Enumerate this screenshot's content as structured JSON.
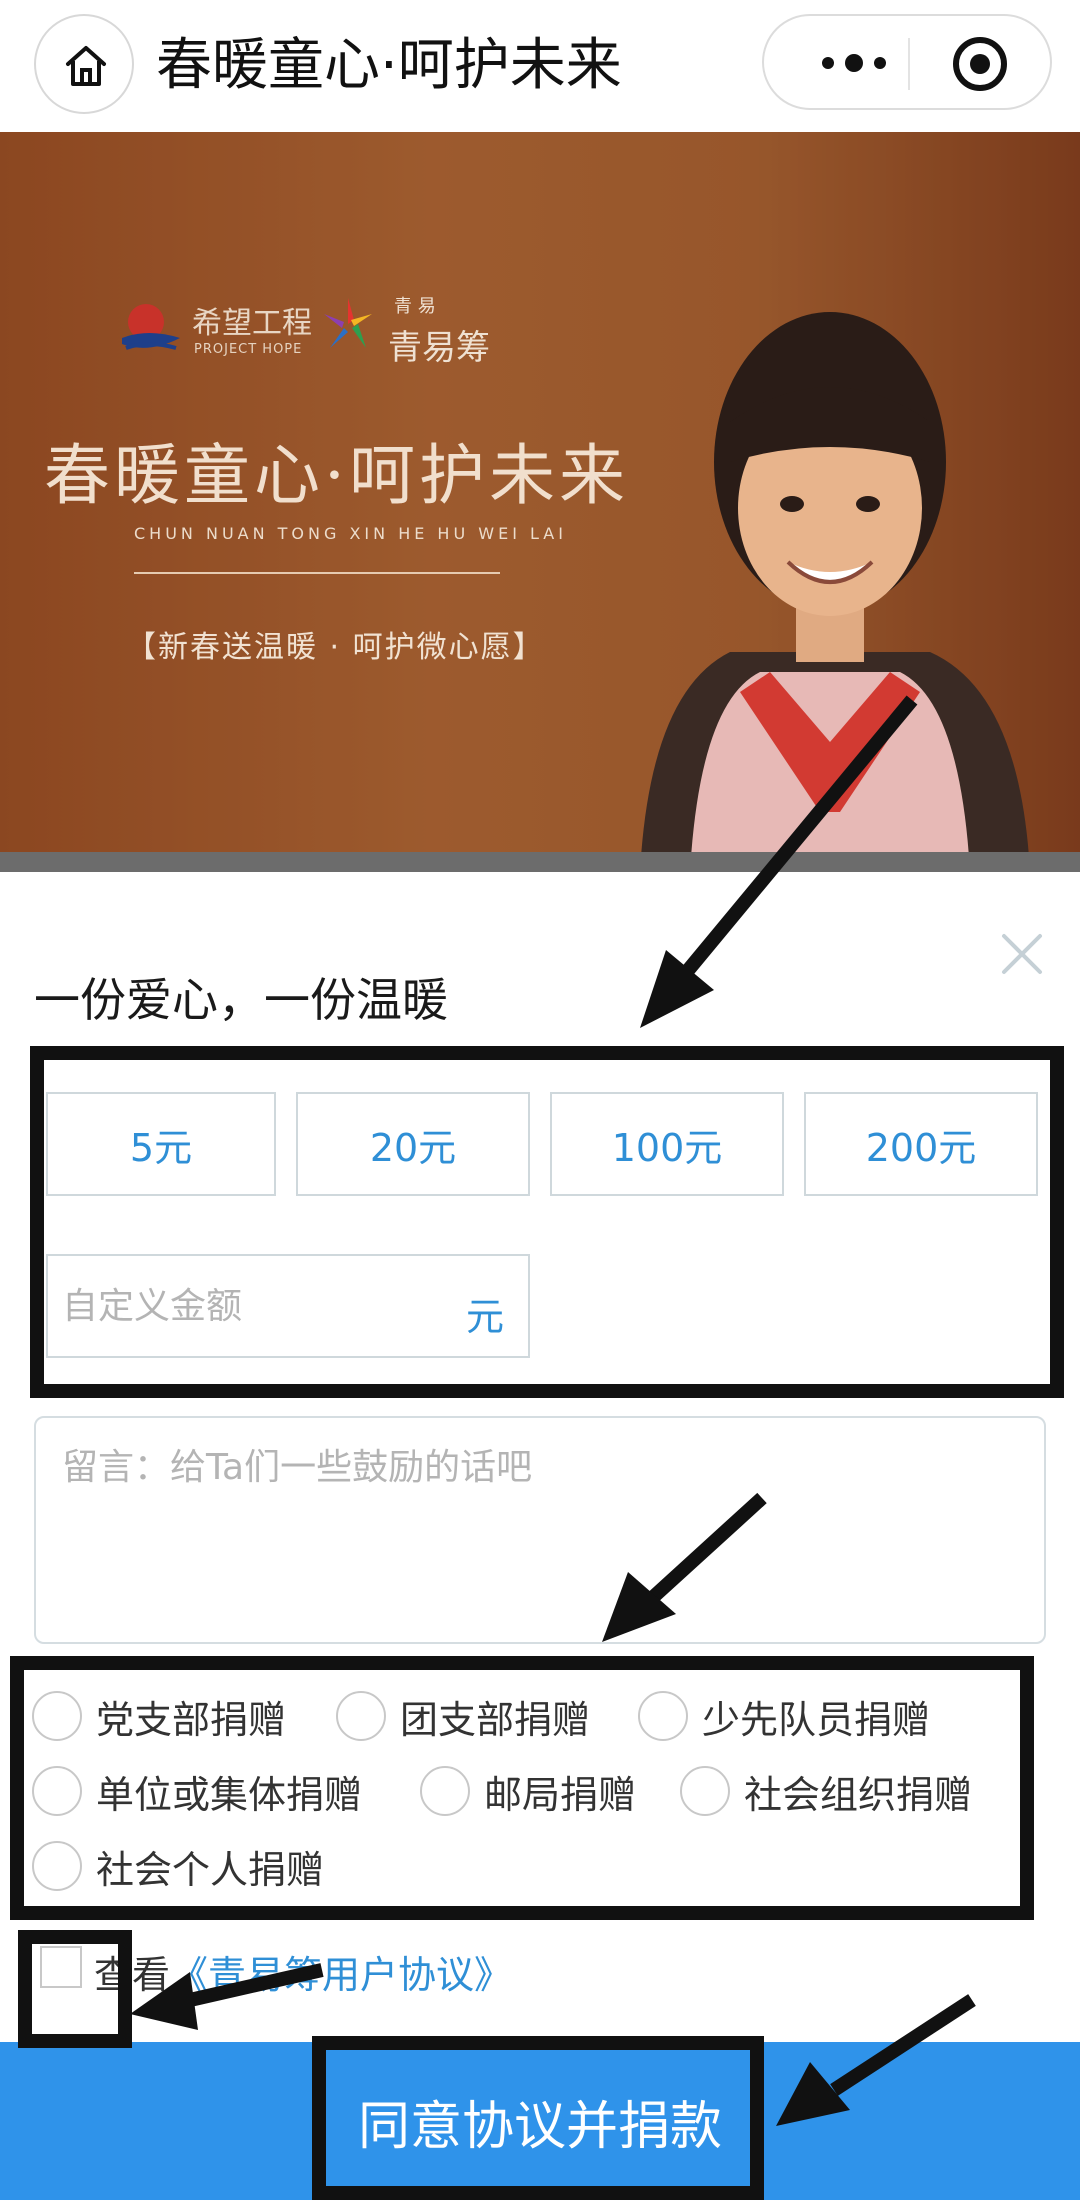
{
  "nav": {
    "title": "春暖童心·呵护未来",
    "home_icon": "home-icon",
    "more_icon": "more-dots-icon",
    "close_mini_icon": "target-icon"
  },
  "banner": {
    "hope_logo_text": "希望工程",
    "hope_logo_sub": "PROJECT HOPE",
    "qyc_logo_small": "青 易",
    "qyc_logo_text": "青易筹",
    "title": "春暖童心·呵护未来",
    "pinyin": "CHUN NUAN TONG XIN HE HU WEI LAI",
    "slogan": "【新春送温暖 · 呵护微心愿】"
  },
  "donation": {
    "heading": "一份爱心，一份温暖",
    "close_icon": "close-icon",
    "amounts": [
      "5元",
      "20元",
      "100元",
      "200元"
    ],
    "custom_amount_placeholder": "自定义金额",
    "custom_amount_unit": "元",
    "message_placeholder": "留言：给Ta们一些鼓励的话吧",
    "donor_types": [
      "党支部捐赠",
      "团支部捐赠",
      "少先队员捐赠",
      "单位或集体捐赠",
      "邮局捐赠",
      "社会组织捐赠",
      "社会个人捐赠"
    ],
    "agreement_prefix": "查看",
    "agreement_link": "《青易筹用户协议》",
    "submit_label": "同意协议并捐款"
  },
  "colors": {
    "accent_blue": "#2f93ea",
    "link_blue": "#2f8fd6",
    "annotation": "#111111"
  }
}
